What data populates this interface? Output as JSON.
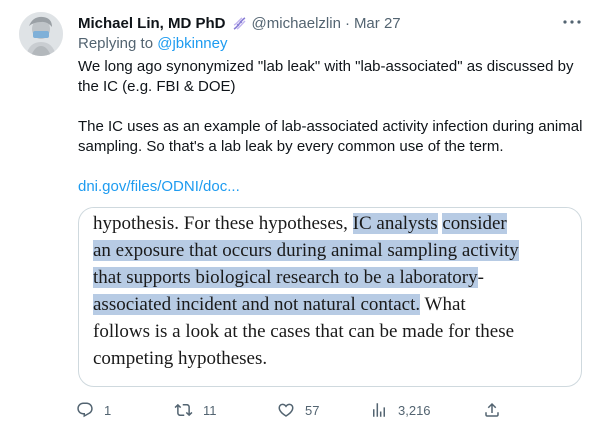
{
  "tweet": {
    "author_name": "Michael Lin, MD PhD",
    "handle": "@michaelzlin",
    "separator": "·",
    "date": "Mar 27",
    "replying_prefix": "Replying to ",
    "replying_to": "@jbkinney",
    "paragraphs": [
      "We long ago synonymized \"lab leak\" with \"lab-associated\" as discussed by the IC (e.g. FBI & DOE)",
      "The IC uses as an example of lab-associated activity infection during animal sampling. So that's a lab leak by every common use of the term."
    ],
    "link_text": "dni.gov/files/ODNI/doc..."
  },
  "media": {
    "lines": [
      [
        {
          "t": "hypothesis.  For these hypotheses, ",
          "h": false
        },
        {
          "t": "IC analysts",
          "h": true
        },
        {
          "t": " ",
          "h": false
        },
        {
          "t": "consider",
          "h": true
        }
      ],
      [
        {
          "t": "an exposure that occurs during animal sampling activity",
          "h": true
        }
      ],
      [
        {
          "t": "that supports biological research to be a laboratory",
          "h": true
        },
        {
          "t": "-",
          "h": false
        }
      ],
      [
        {
          "t": "associated incident and not natural contact.",
          "h": true
        },
        {
          "t": "  What",
          "h": false
        }
      ],
      [
        {
          "t": "follows is a look at the cases that can be made for these",
          "h": false
        }
      ],
      [
        {
          "t": "competing hypotheses.",
          "h": false
        }
      ]
    ],
    "highlight_color": "#b7cbe4"
  },
  "actions": {
    "reply_count": "1",
    "retweet_count": "11",
    "like_count": "57",
    "views_count": "3,216"
  },
  "icons": {
    "badge": "dna-icon",
    "more": "more-dots-icon",
    "reply": "reply-icon",
    "retweet": "retweet-icon",
    "like": "heart-icon",
    "views": "views-chart-icon",
    "share": "share-icon"
  },
  "colors": {
    "link": "#1d9bf0",
    "secondary_text": "#536471",
    "primary_text": "#0f1419",
    "card_border": "#cfd9de"
  }
}
